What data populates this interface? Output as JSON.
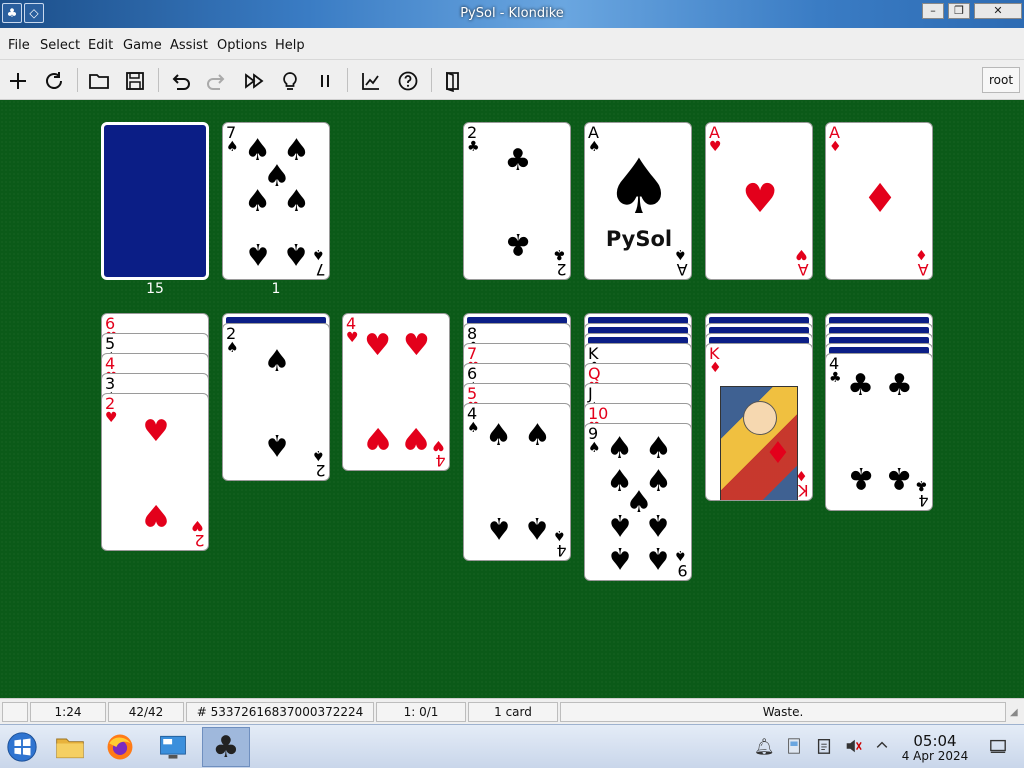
{
  "window": {
    "title": "PySol - Klondike"
  },
  "menu": [
    "File",
    "Select",
    "Edit",
    "Game",
    "Assist",
    "Options",
    "Help"
  ],
  "toolbar": {
    "tools": [
      {
        "name": "new-game-icon",
        "glyph": "plus"
      },
      {
        "name": "restart-icon",
        "glyph": "restart"
      },
      {
        "name": "open-icon",
        "glyph": "folder"
      },
      {
        "name": "save-icon",
        "glyph": "save"
      },
      {
        "name": "undo-icon",
        "glyph": "undo"
      },
      {
        "name": "redo-icon",
        "glyph": "redo"
      },
      {
        "name": "autodrop-icon",
        "glyph": "fastforward"
      },
      {
        "name": "hint-icon",
        "glyph": "bulb"
      },
      {
        "name": "pause-icon",
        "glyph": "pause"
      },
      {
        "name": "statistics-icon",
        "glyph": "chart"
      },
      {
        "name": "rules-icon",
        "glyph": "question"
      },
      {
        "name": "quit-icon",
        "glyph": "door"
      }
    ],
    "player": "root"
  },
  "table": {
    "stock_count": "15",
    "waste_count": "1",
    "waste": {
      "rank": "7",
      "suit": "♠",
      "color": "black"
    },
    "foundations": [
      {
        "rank": "2",
        "suit": "♣",
        "color": "black"
      },
      {
        "rank": "A",
        "suit": "♠",
        "color": "black",
        "logo": "PySol"
      },
      {
        "rank": "A",
        "suit": "♥",
        "color": "red"
      },
      {
        "rank": "A",
        "suit": "♦",
        "color": "red"
      }
    ],
    "tableau": [
      {
        "down": 0,
        "up": [
          {
            "rank": "6",
            "suit": "♥",
            "color": "red"
          },
          {
            "rank": "5",
            "suit": "♠",
            "color": "black"
          },
          {
            "rank": "4",
            "suit": "♥",
            "color": "red"
          },
          {
            "rank": "3",
            "suit": "♠",
            "color": "black"
          },
          {
            "rank": "2",
            "suit": "♥",
            "color": "red"
          }
        ]
      },
      {
        "down": 1,
        "up": [
          {
            "rank": "2",
            "suit": "♠",
            "color": "black"
          }
        ]
      },
      {
        "down": 0,
        "up": [
          {
            "rank": "4",
            "suit": "♥",
            "color": "red"
          }
        ]
      },
      {
        "down": 1,
        "up": [
          {
            "rank": "8",
            "suit": "♣",
            "color": "black"
          },
          {
            "rank": "7",
            "suit": "♥",
            "color": "red"
          },
          {
            "rank": "6",
            "suit": "♠",
            "color": "black"
          },
          {
            "rank": "5",
            "suit": "♥",
            "color": "red"
          },
          {
            "rank": "4",
            "suit": "♠",
            "color": "black"
          }
        ]
      },
      {
        "down": 3,
        "up": [
          {
            "rank": "K",
            "suit": "♣",
            "color": "black"
          },
          {
            "rank": "Q",
            "suit": "♥",
            "color": "red"
          },
          {
            "rank": "J",
            "suit": "♠",
            "color": "black"
          },
          {
            "rank": "10",
            "suit": "♥",
            "color": "red"
          },
          {
            "rank": "9",
            "suit": "♠",
            "color": "black"
          }
        ]
      },
      {
        "down": 3,
        "up": [
          {
            "rank": "K",
            "suit": "♦",
            "color": "red"
          }
        ]
      },
      {
        "down": 4,
        "up": [
          {
            "rank": "4",
            "suit": "♣",
            "color": "black"
          }
        ]
      }
    ]
  },
  "status": {
    "time": "1:24",
    "cards": "42/42",
    "game_number": "# 53372616837000372224",
    "moves": "1: 0/1",
    "selection": "1 card",
    "message": "Waste."
  },
  "taskbar": {
    "clock_time": "05:04",
    "clock_date": "4 Apr 2024"
  }
}
